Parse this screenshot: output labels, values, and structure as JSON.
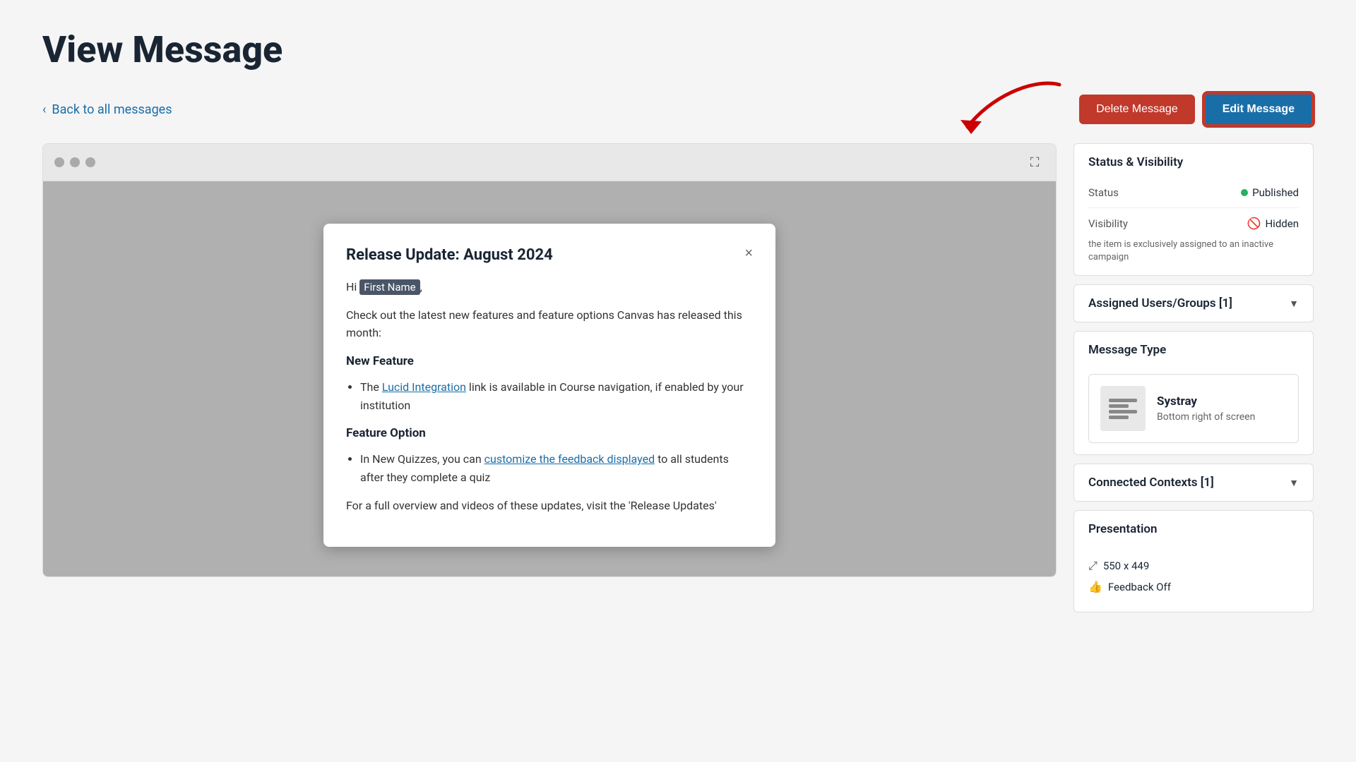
{
  "page": {
    "title": "View Message",
    "back_label": "Back to all messages",
    "delete_button": "Delete Message",
    "edit_button": "Edit Message"
  },
  "preview": {
    "expand_icon": "⛶"
  },
  "message_card": {
    "title": "Release Update: August 2024",
    "close_button": "×",
    "greeting_prefix": "Hi ",
    "first_name_placeholder": "First Name",
    "greeting_suffix": ",",
    "intro": "Check out the latest new features and feature options Canvas has released this month:",
    "section1_title": "New Feature",
    "section1_bullet1_prefix": "The ",
    "section1_bullet1_link": "Lucid Integration",
    "section1_bullet1_suffix": " link is available in Course navigation, if enabled by your institution",
    "section2_title": "Feature Option",
    "section2_bullet1_prefix": "In New Quizzes, you can ",
    "section2_bullet1_link": "customize the feedback displayed",
    "section2_bullet1_suffix": " to all students after they complete a quiz",
    "section3_text": "For a full overview and videos of these updates, visit the 'Release Updates'"
  },
  "sidebar": {
    "status_visibility_title": "Status & Visibility",
    "status_label": "Status",
    "status_value": "Published",
    "visibility_label": "Visibility",
    "visibility_value": "Hidden",
    "visibility_icon": "👁‍🗨",
    "visibility_sub": "the item is exclusively assigned to an inactive campaign",
    "assigned_users_label": "Assigned Users/Groups [1]",
    "message_type_label": "Message Type",
    "message_type_name": "Systray",
    "message_type_desc": "Bottom right of screen",
    "connected_contexts_label": "Connected Contexts [1]",
    "presentation_label": "Presentation",
    "dimensions": "550 x 449",
    "feedback_label": "Feedback Off"
  }
}
